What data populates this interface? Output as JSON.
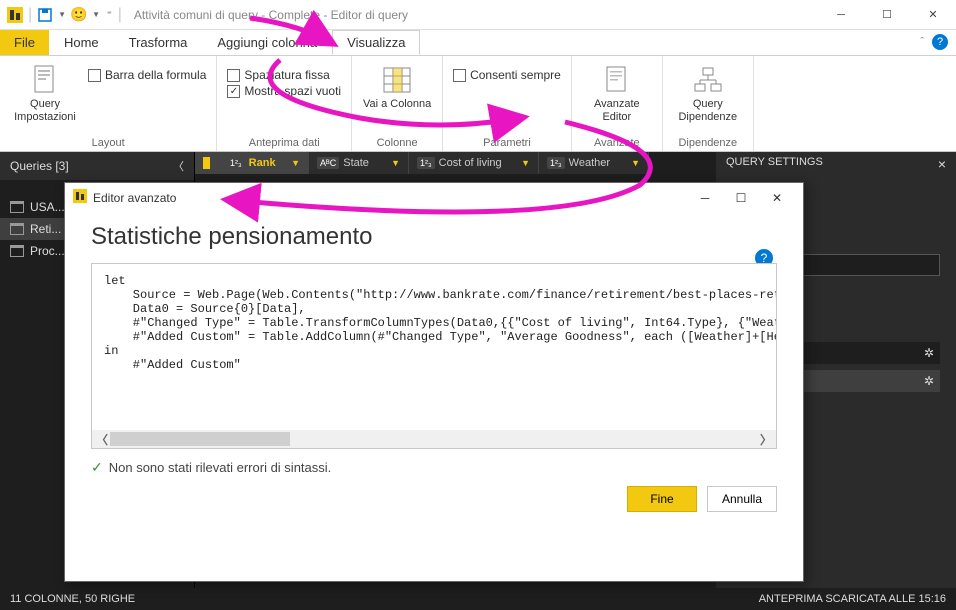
{
  "titlebar": {
    "title": "Attività comuni di query - Complete - Editor di query"
  },
  "menu": {
    "file": "File",
    "tabs": [
      "Home",
      "Trasforma",
      "Aggiungi colonna",
      "Visualizza"
    ]
  },
  "ribbon": {
    "layout": {
      "group_label": "Layout",
      "query_settings": "Query Impostazioni",
      "formula_bar": "Barra della formula"
    },
    "data_preview": {
      "group_label": "Anteprima dati",
      "monospaced": "Spaziatura fissa",
      "show_whitespace": "Mostra spazi vuoti"
    },
    "columns": {
      "group_label": "Colonne",
      "goto_column": "Vai a Colonna"
    },
    "parameters": {
      "group_label": "Parametri",
      "always_allow": "Consenti sempre"
    },
    "advanced": {
      "group_label": "Avanzate",
      "advanced_editor": "Avanzate Editor"
    },
    "dependencies": {
      "group_label": "Dipendenze",
      "query_dependencies": "Query Dipendenze"
    }
  },
  "queries_pane": {
    "header": "Queries [3]",
    "items": [
      {
        "label": "USA..."
      },
      {
        "label": "Reti..."
      },
      {
        "label": "Proc..."
      }
    ]
  },
  "column_headers": [
    {
      "type": "1²₃",
      "name": "Rank"
    },
    {
      "type": "AᴮC",
      "name": "State"
    },
    {
      "type": "1²₃",
      "name": "Cost of living"
    },
    {
      "type": "1²₃",
      "name": "Weather"
    }
  ],
  "settings": {
    "title": "QUERY SETTINGS"
  },
  "advanced_editor": {
    "window_title": "Editor avanzato",
    "heading": "Statistiche pensionamento",
    "code": "let\n    Source = Web.Page(Web.Contents(\"http://www.bankrate.com/finance/retirement/best-places-retire-how-s\n    Data0 = Source{0}[Data],\n    #\"Changed Type\" = Table.TransformColumnTypes(Data0,{{\"Cost of living\", Int64.Type}, {\"Weather\", Int\n    #\"Added Custom\" = Table.AddColumn(#\"Changed Type\", \"Average Goodness\", each ([Weather]+[Health care\nin\n    #\"Added Custom\"",
    "no_errors": "Non sono stati rilevati errori di sintassi.",
    "done": "Fine",
    "cancel": "Annulla"
  },
  "statusbar": {
    "left": "11 COLONNE, 50 RIGHE",
    "right": "ANTEPRIMA SCARICATA ALLE 15:16"
  }
}
